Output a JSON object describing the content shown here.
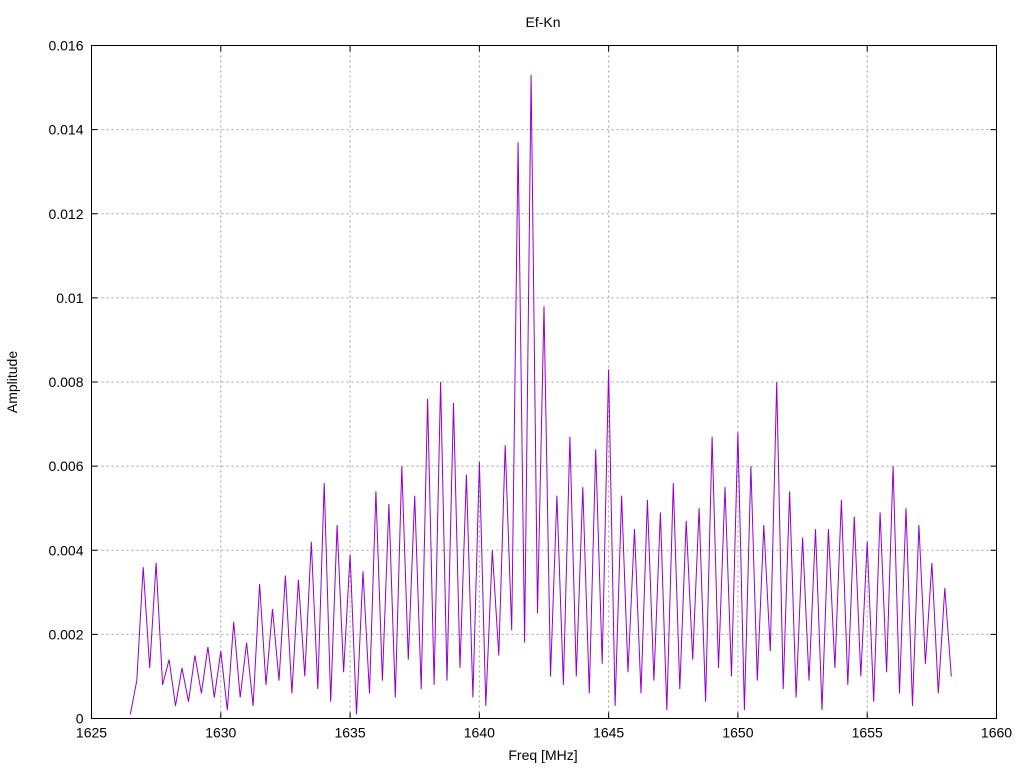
{
  "chart_data": {
    "type": "line",
    "title": "Ef-Kn",
    "xlabel": "Freq [MHz]",
    "ylabel": "Amplitude",
    "xlim": [
      1625,
      1660
    ],
    "ylim": [
      0,
      0.016
    ],
    "grid": true,
    "xticks": [
      "1625",
      "1630",
      "1635",
      "1640",
      "1645",
      "1650",
      "1655",
      "1660"
    ],
    "yticks": [
      "0",
      "0.002",
      "0.004",
      "0.006",
      "0.008",
      "0.01",
      "0.012",
      "0.014",
      "0.016"
    ],
    "series": [
      {
        "name": "Ef-Kn",
        "color": "#9400d3",
        "x_start": 1626.5,
        "x_step": 0.25,
        "values": [
          0.0001,
          0.0009,
          0.0036,
          0.0012,
          0.0037,
          0.0008,
          0.0014,
          0.0003,
          0.0012,
          0.0004,
          0.0015,
          0.0006,
          0.0017,
          0.0005,
          0.0016,
          0.0002,
          0.0023,
          0.0005,
          0.0018,
          0.0003,
          0.0032,
          0.0008,
          0.0026,
          0.0009,
          0.0034,
          0.0006,
          0.0033,
          0.001,
          0.0042,
          0.0007,
          0.0056,
          0.0004,
          0.0046,
          0.0011,
          0.0039,
          0.0001,
          0.0035,
          0.0006,
          0.0054,
          0.0009,
          0.0051,
          0.0005,
          0.006,
          0.0014,
          0.0053,
          0.0007,
          0.0076,
          0.0008,
          0.008,
          0.0009,
          0.0075,
          0.0012,
          0.0058,
          0.0005,
          0.0061,
          0.0003,
          0.004,
          0.0015,
          0.0065,
          0.0021,
          0.0137,
          0.0018,
          0.0153,
          0.0025,
          0.0098,
          0.001,
          0.0053,
          0.0008,
          0.0067,
          0.001,
          0.0055,
          0.0006,
          0.0064,
          0.0013,
          0.0083,
          0.0003,
          0.0053,
          0.0011,
          0.0045,
          0.0006,
          0.0052,
          0.0009,
          0.0049,
          0.0002,
          0.0056,
          0.0007,
          0.0047,
          0.0014,
          0.005,
          0.0004,
          0.0067,
          0.0012,
          0.0055,
          0.001,
          0.0068,
          0.0002,
          0.006,
          0.0009,
          0.0046,
          0.0016,
          0.008,
          0.0007,
          0.0054,
          0.0005,
          0.0043,
          0.0009,
          0.0045,
          0.0002,
          0.0045,
          0.0012,
          0.0052,
          0.0008,
          0.0048,
          0.001,
          0.0042,
          0.0004,
          0.0049,
          0.0011,
          0.006,
          0.0006,
          0.005,
          0.0003,
          0.0046,
          0.0013,
          0.0037,
          0.0006,
          0.0031,
          0.001
        ]
      }
    ]
  }
}
